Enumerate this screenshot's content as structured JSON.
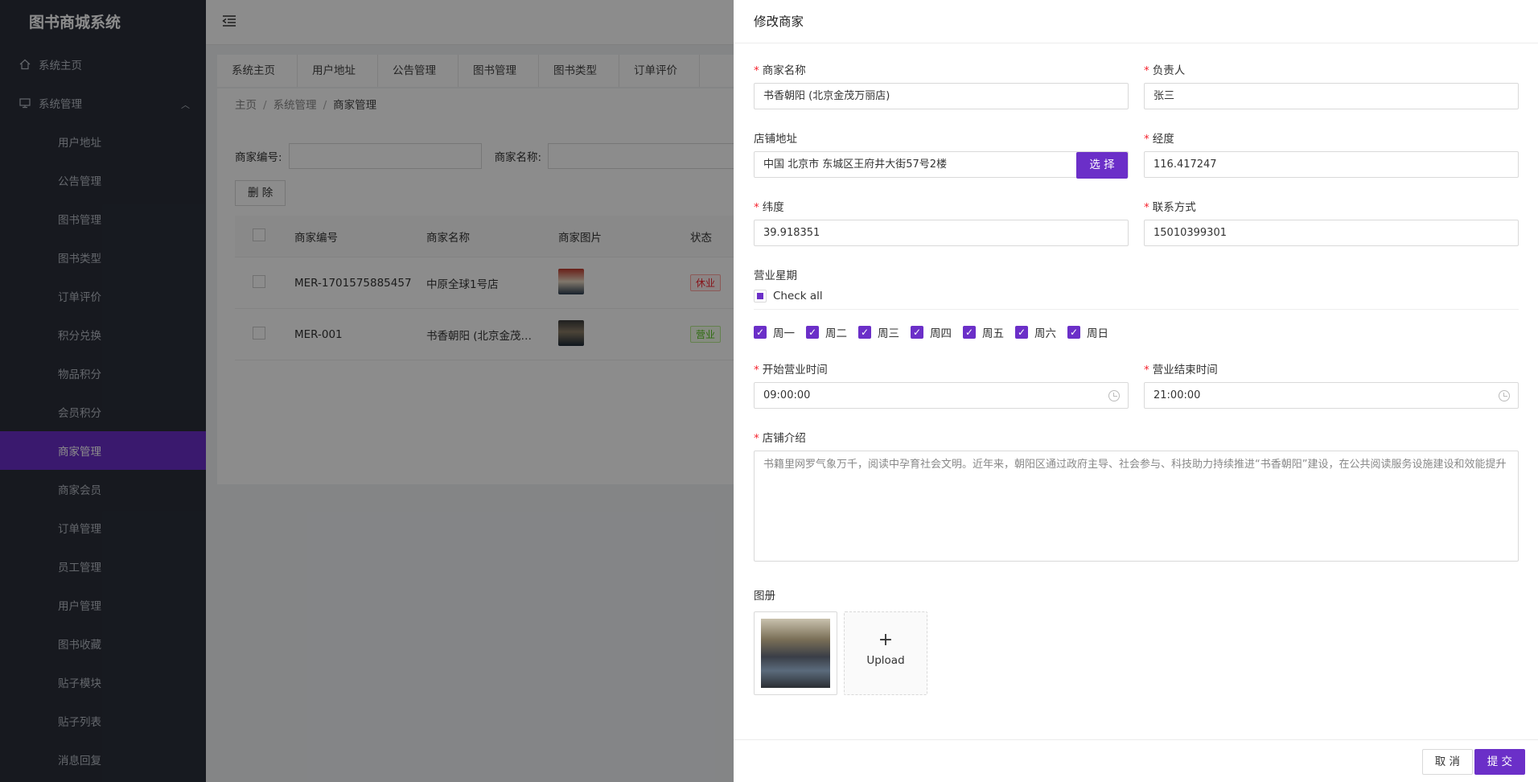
{
  "app": {
    "title": "图书商城系统"
  },
  "sidebar": {
    "home": "系统主页",
    "group": "系统管理",
    "items": [
      "用户地址",
      "公告管理",
      "图书管理",
      "图书类型",
      "订单评价",
      "积分兑换",
      "物品积分",
      "会员积分",
      "商家管理",
      "商家会员",
      "订单管理",
      "员工管理",
      "用户管理",
      "图书收藏",
      "贴子模块",
      "贴子列表",
      "消息回复"
    ],
    "active": "商家管理"
  },
  "tabs": [
    "系统主页",
    "用户地址",
    "公告管理",
    "图书管理",
    "图书类型",
    "订单评价"
  ],
  "breadcrumb": {
    "home": "主页",
    "section": "系统管理",
    "current": "商家管理"
  },
  "search": {
    "code_label": "商家编号:",
    "name_label": "商家名称:"
  },
  "toolbar": {
    "delete_label": "删 除"
  },
  "table": {
    "columns": [
      "商家编号",
      "商家名称",
      "商家图片",
      "状态"
    ],
    "rows": [
      {
        "code": "MER-1701575885457",
        "name": "中原全球1号店",
        "status": "休业"
      },
      {
        "code": "MER-001",
        "name": "书香朝阳 (北京金茂…",
        "status": "营业"
      }
    ]
  },
  "drawer": {
    "title": "修改商家",
    "fields": {
      "merchant_name": {
        "label": "商家名称",
        "value": "书香朝阳 (北京金茂万丽店)"
      },
      "manager": {
        "label": "负责人",
        "value": "张三"
      },
      "address": {
        "label": "店铺地址",
        "value": "中国 北京市 东城区王府井大街57号2楼",
        "button": "选 择"
      },
      "longitude": {
        "label": "经度",
        "value": "116.417247"
      },
      "latitude": {
        "label": "纬度",
        "value": "39.918351"
      },
      "contact": {
        "label": "联系方式",
        "value": "15010399301"
      },
      "weekdays": {
        "label": "营业星期",
        "check_all": "Check all",
        "options": [
          "周一",
          "周二",
          "周三",
          "周四",
          "周五",
          "周六",
          "周日"
        ]
      },
      "open_time": {
        "label": "开始营业时间",
        "value": "09:00:00"
      },
      "close_time": {
        "label": "营业结束时间",
        "value": "21:00:00"
      },
      "intro": {
        "label": "店铺介绍",
        "value": "书籍里网罗气象万千，阅读中孕育社会文明。近年来，朝阳区通过政府主导、社会参与、科技助力持续推进“书香朝阳”建设，在公共阅读服务设施建设和效能提升"
      },
      "album": {
        "label": "图册",
        "upload": "Upload"
      }
    },
    "cancel_label": "取 消",
    "submit_label": "提 交"
  },
  "colors": {
    "accent": "#6b2fc8",
    "sidebar": "#2a2f3a"
  }
}
